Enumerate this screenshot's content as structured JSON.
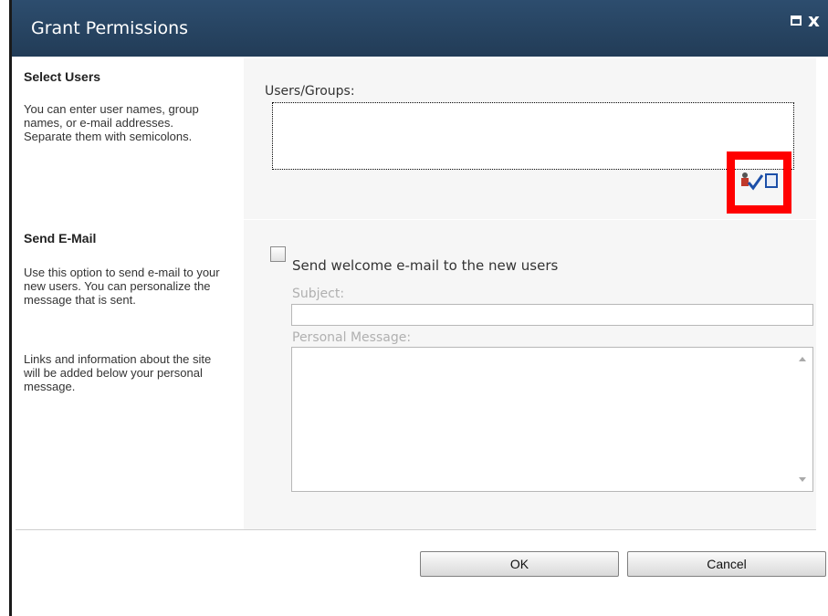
{
  "dialog": {
    "title": "Grant Permissions",
    "maximize_icon": "maximize-icon",
    "close_icon": "close-icon",
    "close_glyph": "x"
  },
  "select_users": {
    "title": "Select Users",
    "description": "You can enter user names, group names, or e-mail addresses. Separate them with semicolons.",
    "field_label": "Users/Groups:",
    "field_value": "",
    "check_names_icon": "check-names-icon",
    "browse_icon": "address-book-icon"
  },
  "send_email": {
    "title": "Send E-Mail",
    "description_1": "Use this option to send e-mail to your new users. You can personalize the message that is sent.",
    "description_2": "Links and information about the site will be added below your personal message.",
    "checkbox_label": "Send welcome e-mail to the new users",
    "checkbox_checked": false,
    "subject_label": "Subject:",
    "subject_value": "",
    "message_label": "Personal Message:",
    "message_value": ""
  },
  "buttons": {
    "ok": "OK",
    "cancel": "Cancel"
  },
  "colors": {
    "title_bar": "#284563",
    "highlight": "#ff0000",
    "section_right_bg": "#f6f6f6"
  }
}
